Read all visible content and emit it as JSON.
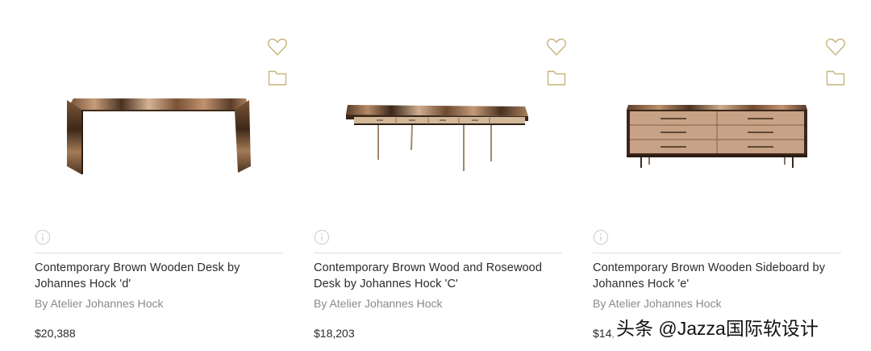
{
  "accent_color": "#c9b27c",
  "listings": [
    {
      "title": "Contemporary Brown Wooden Desk by Johannes Hock 'd'",
      "maker": "By Atelier Johannes Hock",
      "price": "$20,388",
      "image": "waterfall-desk"
    },
    {
      "title": "Contemporary Brown Wood and Rosewood Desk by Johannes Hock 'C'",
      "maker": "By Atelier Johannes Hock",
      "price": "$18,203",
      "image": "writing-desk"
    },
    {
      "title": "Contemporary Brown Wooden Sideboard by Johannes Hock 'e'",
      "maker": "By Atelier Johannes Hock",
      "price": "$14,",
      "image": "sideboard"
    }
  ],
  "icons": {
    "favorite": "heart-icon",
    "save": "folder-icon",
    "info": "info-icon"
  },
  "watermark": "头条 @Jazza国际软设计"
}
